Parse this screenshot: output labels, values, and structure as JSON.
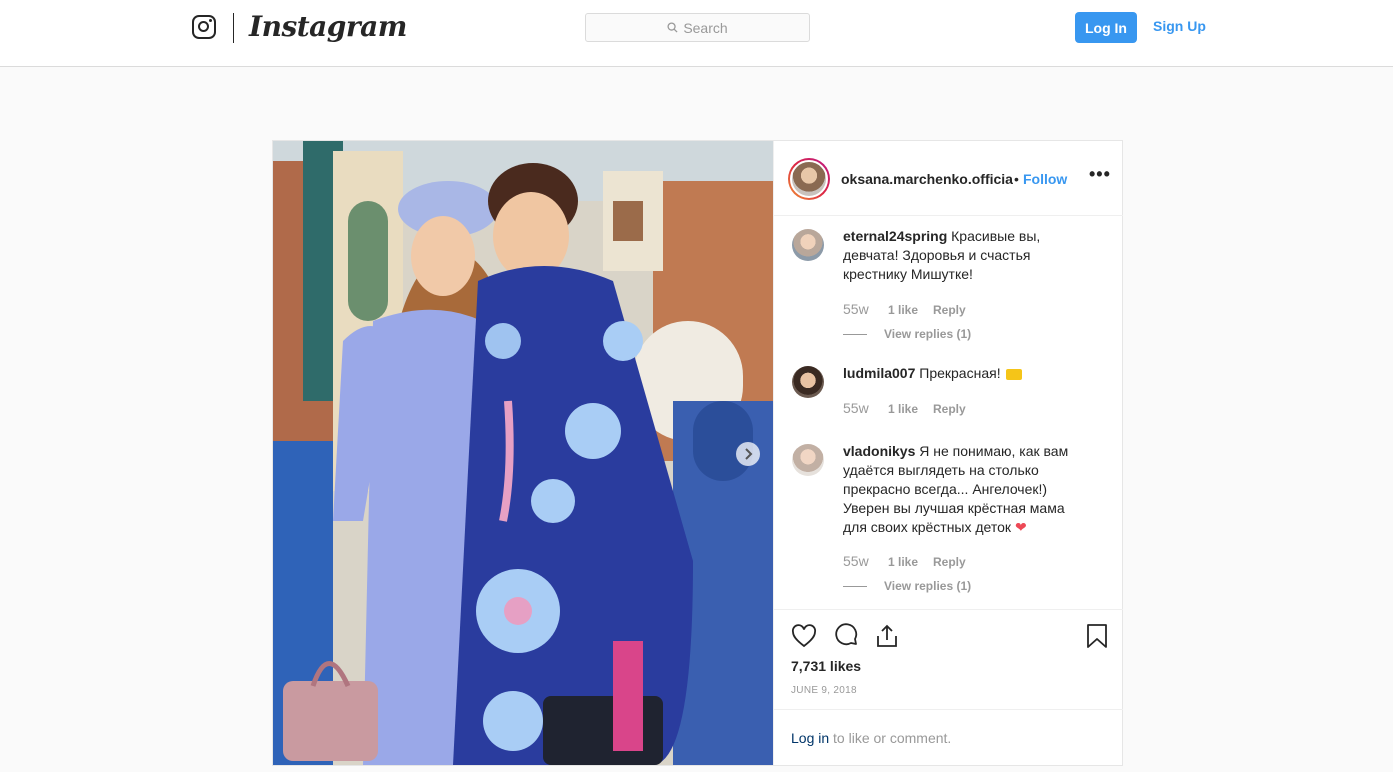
{
  "header": {
    "logo_text": "Instagram",
    "search_placeholder": "Search",
    "login_label": "Log In",
    "signup_label": "Sign Up"
  },
  "post": {
    "owner_username": "oksana.marchenko.officia",
    "separator": "•",
    "follow_label": "Follow",
    "more_label": "•••",
    "comments": [
      {
        "username": "eternal24spring",
        "text": "Красивые вы, девчата! Здоровья и счастья крестнику Мишутке!",
        "age": "55w",
        "likes": "1 like",
        "reply_label": "Reply",
        "view_replies": "View replies (1)"
      },
      {
        "username": "ludmila007",
        "text": "Прекрасная!",
        "age": "55w",
        "likes": "1 like",
        "reply_label": "Reply"
      },
      {
        "username": "vladonikys",
        "text": "Я не понимаю, как вам удаётся выглядеть на столько прекрасно всегда... Ангелочек!) Уверен вы лучшая крёстная мама для своих крёстных деток",
        "heart": "❤",
        "age": "55w",
        "likes": "1 like",
        "reply_label": "Reply",
        "view_replies": "View replies (1)"
      }
    ],
    "likes_count": "7,731 likes",
    "date": "JUNE 9, 2018",
    "login_prompt_link": "Log in",
    "login_prompt_rest": " to like or comment."
  },
  "icons": [
    "instagram-glyph-icon",
    "search-icon",
    "heart-icon",
    "comment-icon",
    "share-icon",
    "bookmark-icon",
    "chevron-right-icon"
  ],
  "colors": {
    "accent": "#3897f0",
    "text": "#262626",
    "muted": "#999999",
    "heart": "#ed4956"
  }
}
